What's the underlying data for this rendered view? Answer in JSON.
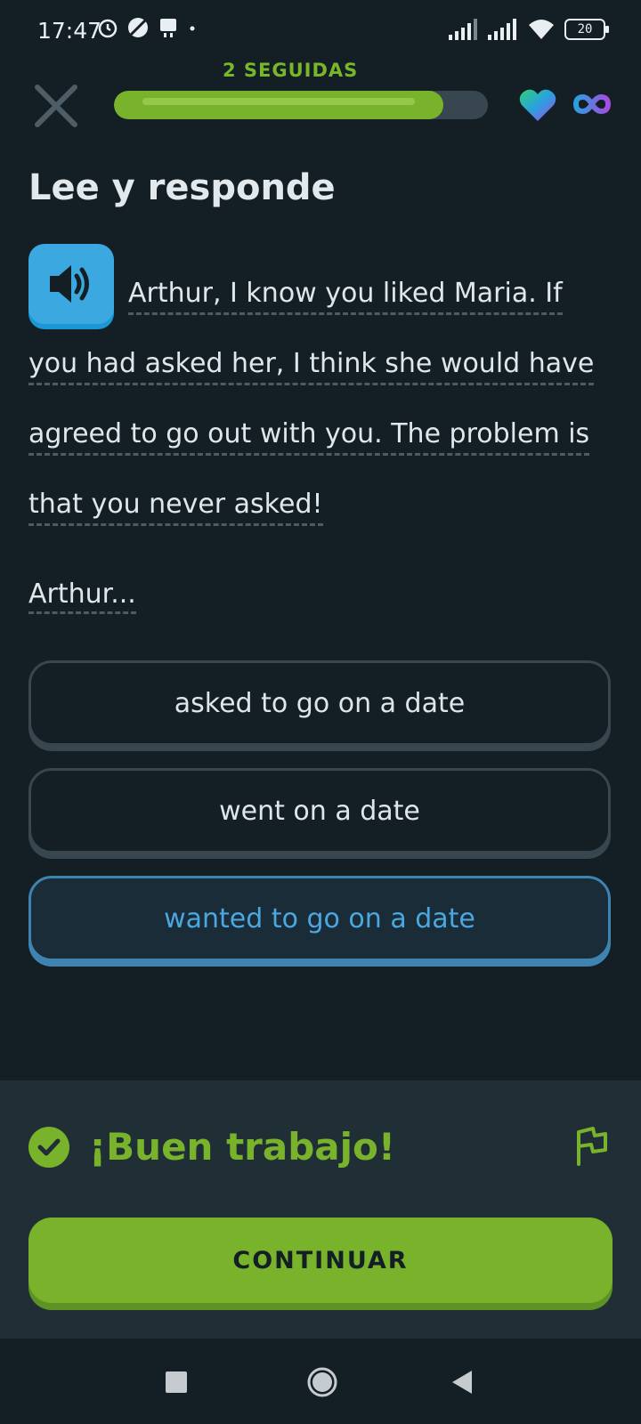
{
  "status_bar": {
    "time": "17:47",
    "battery": "20"
  },
  "header": {
    "streak": "2 SEGUIDAS",
    "progress": 0.88
  },
  "exercise": {
    "title": "Lee y responde",
    "passage_lines": [
      "Arthur, I know you liked Maria. If",
      "you had asked her, I think she would have",
      "agreed to go out with you. The problem is",
      "that you never asked!"
    ],
    "prompt": "Arthur...",
    "options": [
      {
        "label": "asked to go on a date",
        "selected": false
      },
      {
        "label": "went on a date",
        "selected": false
      },
      {
        "label": "wanted to go on a date",
        "selected": true
      }
    ]
  },
  "feedback": {
    "title": "¡Buen trabajo!",
    "continue_label": "CONTINUAR"
  },
  "colors": {
    "accent_green": "#78b32b",
    "selected_blue": "#4aa7df",
    "background": "#131f24"
  }
}
